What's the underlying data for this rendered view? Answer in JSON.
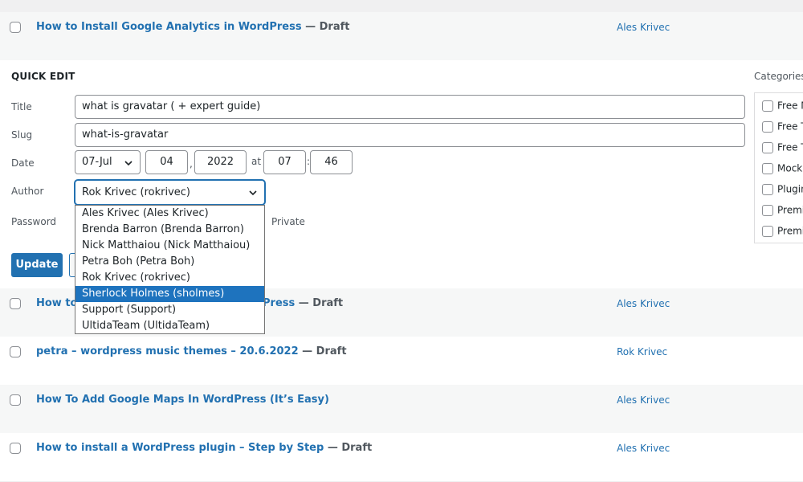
{
  "rows": [
    {
      "title": "How to Install Google Analytics in WordPress",
      "state": "— Draft",
      "author": "Ales Krivec"
    },
    {
      "title": "How to",
      "title_tail": "Press",
      "state": "— Draft",
      "author": "Ales Krivec"
    },
    {
      "title": "petra – wordpress music themes – 20.6.2022",
      "state": "— Draft",
      "author": "Rok Krivec"
    },
    {
      "title": "How To Add Google Maps In WordPress (It’s Easy)",
      "state": "",
      "author": "Ales Krivec"
    },
    {
      "title": "How to install a WordPress plugin – Step by Step",
      "state": "— Draft",
      "author": "Ales Krivec"
    }
  ],
  "quick_edit": {
    "heading": "QUICK EDIT",
    "title_label": "Title",
    "title_value": "what is gravatar ( + expert guide)",
    "slug_label": "Slug",
    "slug_value": "what-is-gravatar",
    "date_label": "Date",
    "date_month": "07-Jul",
    "date_day": "04",
    "date_year": "2022",
    "date_at": "at",
    "date_hour": "07",
    "date_minute": "46",
    "author_label": "Author",
    "author_value": "Rok Krivec (rokrivec)",
    "password_label": "Password",
    "private_label": "Private",
    "update_button": "Update",
    "categories_label": "Categories",
    "categories": [
      "Free M",
      "Free T",
      "Free T",
      "Mock",
      "Plugin",
      "Premi",
      "Premi"
    ]
  },
  "author_dropdown": {
    "options": [
      "Ales Krivec (Ales Krivec)",
      "Brenda Barron (Brenda Barron)",
      "Nick Matthaiou (Nick Matthaiou)",
      "Petra Boh (Petra Boh)",
      "Rok Krivec (rokrivec)",
      "Sherlock Holmes (sholmes)",
      "Support (Support)",
      "UltidaTeam (UltidaTeam)"
    ],
    "highlighted_index": 5
  },
  "colors": {
    "link": "#2271b1",
    "primary_button": "#2271b1",
    "highlight": "#1e73be"
  }
}
